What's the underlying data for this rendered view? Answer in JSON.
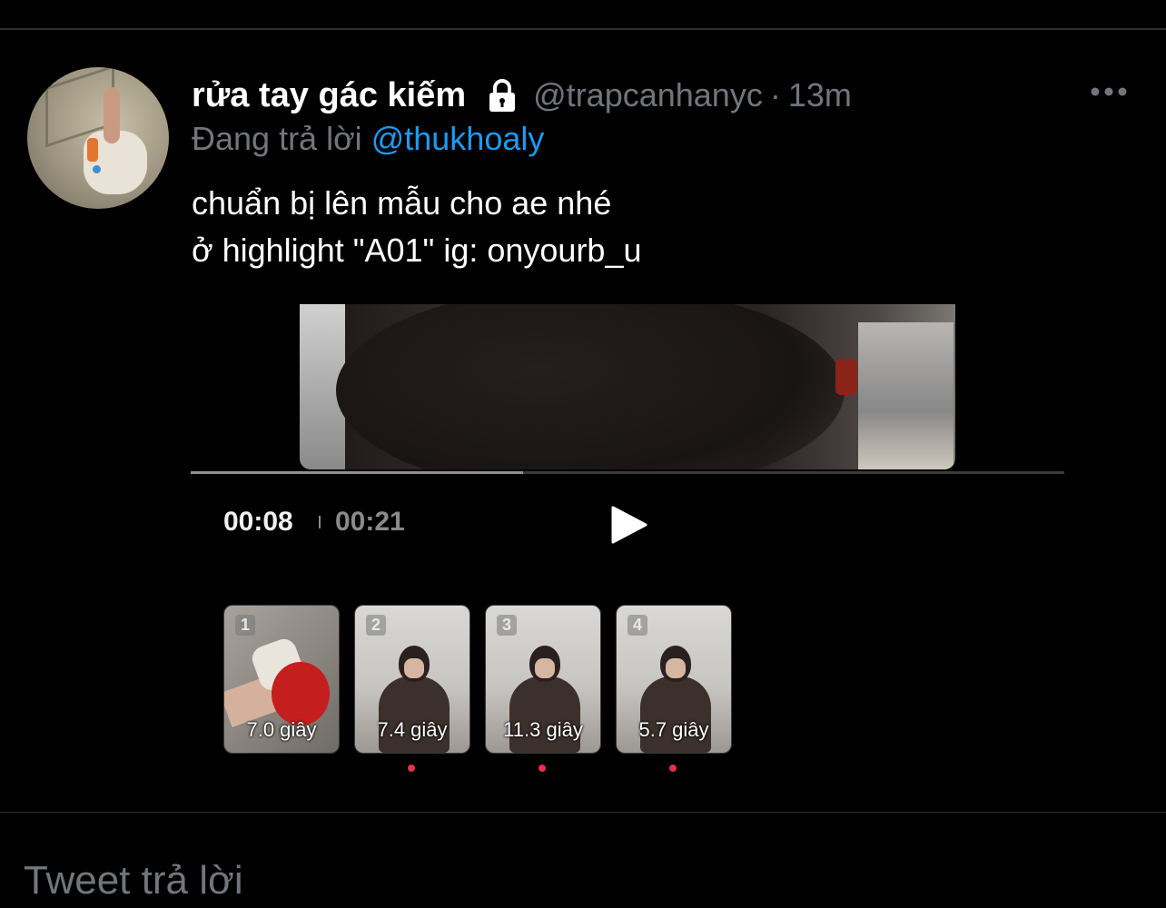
{
  "tweet": {
    "display_name": "rửa tay gác kiếm",
    "handle": "@trapcanhanyc",
    "separator": "·",
    "time": "13m",
    "reply_prefix": "Đang trả lời",
    "reply_to": "@thukhoaly",
    "text": "chuẩn bị lên mẫu cho ae nhé\nở highlight \"A01\" ig: onyourb_u",
    "icons": {
      "protected": "lock-icon",
      "menu": "more-icon"
    }
  },
  "media": {
    "current_time": "00:08",
    "total_time": "00:21",
    "progress": 0.38,
    "play_icon": "play-icon",
    "clips": [
      {
        "number": "1",
        "duration": "7.0 giây",
        "marked": false
      },
      {
        "number": "2",
        "duration": "7.4 giây",
        "marked": true
      },
      {
        "number": "3",
        "duration": "11.3 giây",
        "marked": true
      },
      {
        "number": "4",
        "duration": "5.7 giây",
        "marked": true
      }
    ],
    "marker_color": "#e6304a"
  },
  "reply_box": {
    "placeholder": "Tweet trả lời"
  },
  "colors": {
    "background": "#000000",
    "mention": "#1d9bf0",
    "muted": "#71767b"
  }
}
